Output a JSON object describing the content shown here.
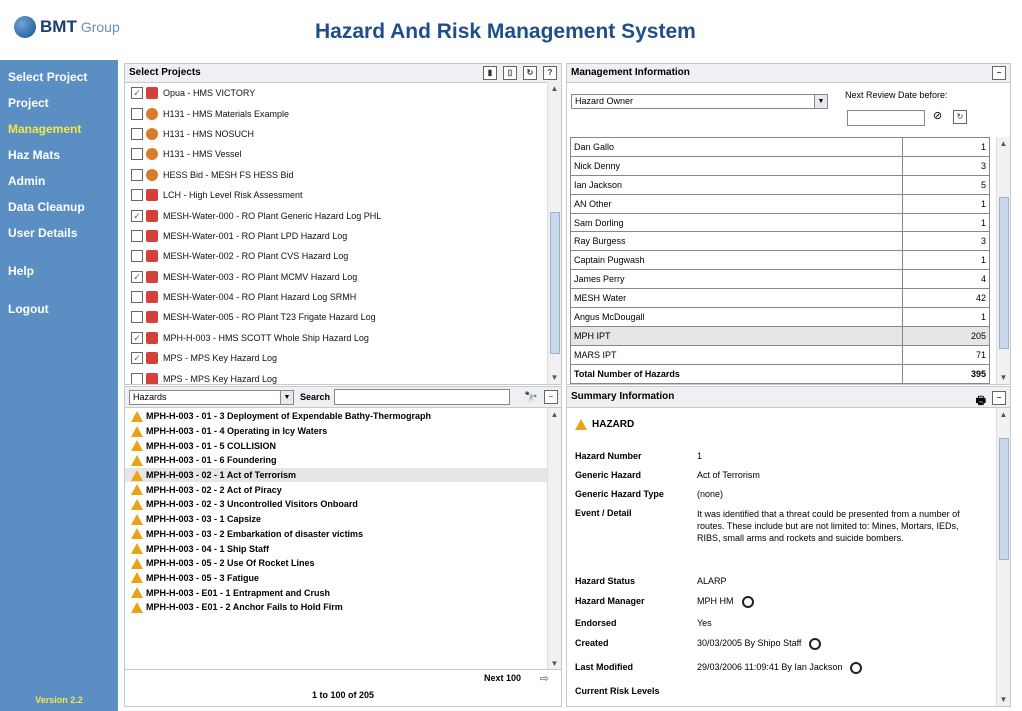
{
  "header": {
    "logo_bmt": "BMT",
    "logo_group": "Group",
    "title": "Hazard And Risk Management System"
  },
  "sidebar": {
    "items": [
      {
        "label": "Select Project"
      },
      {
        "label": "Project"
      },
      {
        "label": "Management"
      },
      {
        "label": "Haz Mats"
      },
      {
        "label": "Admin"
      },
      {
        "label": "Data Cleanup"
      },
      {
        "label": "User Details"
      },
      {
        "label": "Help"
      },
      {
        "label": "Logout"
      }
    ],
    "active": "Management",
    "version": "Version 2.2"
  },
  "projects": {
    "title": "Select Projects",
    "rows": [
      {
        "text": "Opua - HMS VICTORY",
        "checked": true,
        "icon": "red"
      },
      {
        "text": "H131 - HMS Materials Example",
        "checked": false,
        "icon": "orange"
      },
      {
        "text": "H131 - HMS NOSUCH",
        "checked": false,
        "icon": "orange"
      },
      {
        "text": "H131 - HMS Vessel",
        "checked": false,
        "icon": "orange"
      },
      {
        "text": "HESS Bid - MESH FS HESS Bid",
        "checked": false,
        "icon": "orange"
      },
      {
        "text": "LCH - High Level Risk Assessment",
        "checked": false,
        "icon": "red"
      },
      {
        "text": "MESH-Water-000 - RO Plant Generic Hazard Log PHL",
        "checked": true,
        "icon": "red"
      },
      {
        "text": "MESH-Water-001 - RO Plant LPD Hazard Log",
        "checked": false,
        "icon": "red"
      },
      {
        "text": "MESH-Water-002 - RO Plant CVS Hazard Log",
        "checked": false,
        "icon": "red"
      },
      {
        "text": "MESH-Water-003 - RO Plant MCMV Hazard Log",
        "checked": true,
        "icon": "red"
      },
      {
        "text": "MESH-Water-004 - RO Plant Hazard Log SRMH",
        "checked": false,
        "icon": "red"
      },
      {
        "text": "MESH-Water-005 - RO Plant T23 Frigate Hazard Log",
        "checked": false,
        "icon": "red"
      },
      {
        "text": "MPH-H-003 - HMS SCOTT Whole Ship Hazard Log",
        "checked": true,
        "icon": "red"
      },
      {
        "text": "MPS - MPS Key Hazard Log",
        "checked": true,
        "icon": "red"
      },
      {
        "text": "MPS - MPS Key Hazard Log",
        "checked": false,
        "icon": "red"
      }
    ]
  },
  "hazards": {
    "filter": "Hazards",
    "search_label": "Search",
    "search_value": "",
    "rows": [
      {
        "text": "MPH-H-003 - 01 - 3 Deployment of Expendable Bathy-Thermograph"
      },
      {
        "text": "MPH-H-003 - 01 - 4 Operating in Icy Waters"
      },
      {
        "text": "MPH-H-003 - 01 - 5 COLLISION"
      },
      {
        "text": "MPH-H-003 - 01 - 6 Foundering"
      },
      {
        "text": "MPH-H-003 - 02 - 1 Act of Terrorism",
        "selected": true
      },
      {
        "text": "MPH-H-003 - 02 - 2 Act of Piracy"
      },
      {
        "text": "MPH-H-003 - 02 - 3 Uncontrolled Visitors Onboard"
      },
      {
        "text": "MPH-H-003 - 03 - 1 Capsize"
      },
      {
        "text": "MPH-H-003 - 03 - 2 Embarkation of disaster victims"
      },
      {
        "text": "MPH-H-003 - 04 - 1 Ship Staff"
      },
      {
        "text": "MPH-H-003 - 05 - 2 Use Of Rocket Lines"
      },
      {
        "text": "MPH-H-003 - 05 - 3 Fatigue"
      },
      {
        "text": "MPH-H-003 - E01 - 1 Entrapment and Crush"
      },
      {
        "text": "MPH-H-003 - E01 - 2 Anchor Fails to Hold Firm"
      }
    ],
    "next_label": "Next 100",
    "paging": "1 to 100 of 205"
  },
  "management": {
    "title": "Management Information",
    "group_by": "Hazard Owner",
    "review_label": "Next Review Date before:",
    "review_value": "",
    "rows": [
      {
        "name": "Dan Gallo",
        "count": "1"
      },
      {
        "name": "Nick Denny",
        "count": "3"
      },
      {
        "name": "Ian Jackson",
        "count": "5"
      },
      {
        "name": "AN Other",
        "count": "1"
      },
      {
        "name": "Sam Dorling",
        "count": "1"
      },
      {
        "name": "Ray Burgess",
        "count": "3"
      },
      {
        "name": "Captain Pugwash",
        "count": "1"
      },
      {
        "name": "James Perry",
        "count": "4"
      },
      {
        "name": "MESH Water",
        "count": "42"
      },
      {
        "name": "Angus McDougall",
        "count": "1"
      },
      {
        "name": "MPH IPT",
        "count": "205",
        "highlight": true
      },
      {
        "name": "MARS IPT",
        "count": "71"
      }
    ],
    "total_label": "Total Number of Hazards",
    "total_value": "395"
  },
  "summary": {
    "title": "Summary Information",
    "heading": "HAZARD",
    "fields": [
      {
        "label": "Hazard Number",
        "value": "1"
      },
      {
        "label": "Generic Hazard",
        "value": "Act of Terrorism"
      },
      {
        "label": "Generic Hazard Type",
        "value": "(none)"
      },
      {
        "label": "Event / Detail",
        "value": "It was identified that a threat could be presented from a number of routes.  These include but are not limited to: Mines, Mortars, IEDs, RIBS, small arms and rockets and suicide bombers."
      },
      {
        "label": "Hazard Status",
        "value": "ALARP"
      },
      {
        "label": "Hazard Manager",
        "value": "MPH HM"
      },
      {
        "label": "Endorsed",
        "value": "Yes"
      },
      {
        "label": "Created",
        "value": "30/03/2005  By  Shipo Staff"
      },
      {
        "label": "Last Modified",
        "value": "29/03/2006 11:09:41  By  Ian Jackson"
      },
      {
        "label": "Current Risk Levels",
        "value": ""
      }
    ]
  }
}
